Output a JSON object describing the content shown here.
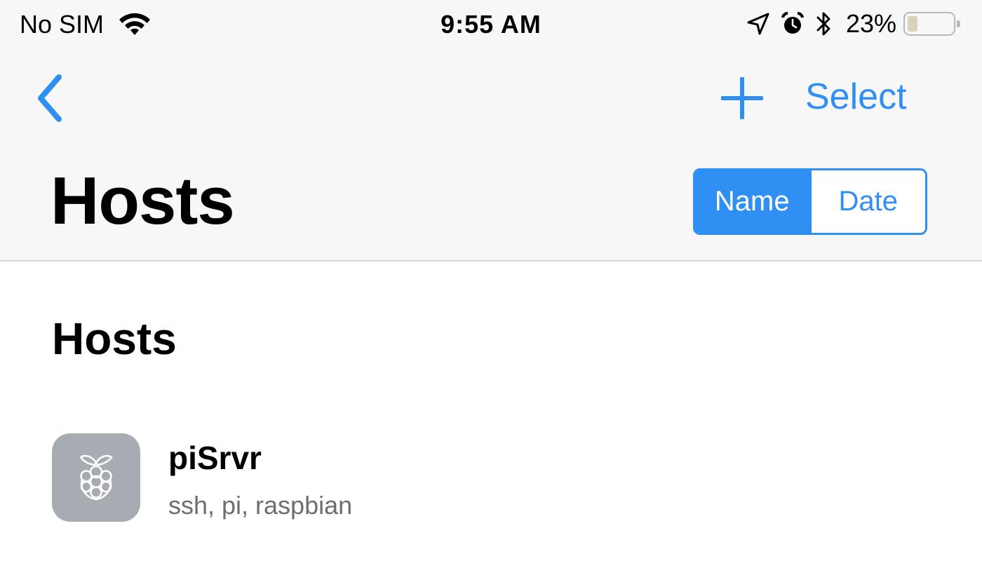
{
  "status_bar": {
    "carrier": "No SIM",
    "time": "9:55 AM",
    "battery_percent": "23%",
    "battery_level": 0.23,
    "icons": [
      "wifi-icon",
      "location-arrow-icon",
      "alarm-clock-icon",
      "bluetooth-icon",
      "battery-icon"
    ]
  },
  "nav": {
    "back_icon": "chevron-left-icon",
    "add_icon": "plus-icon",
    "select_label": "Select",
    "title": "Hosts"
  },
  "sort": {
    "options": [
      "Name",
      "Date"
    ],
    "selected": "Name"
  },
  "section": {
    "header": "Hosts"
  },
  "hosts": [
    {
      "name": "piSrvr",
      "detail": "ssh, pi, raspbian",
      "icon": "raspberry-pi-icon"
    }
  ],
  "colors": {
    "accent": "#2f8ff2",
    "icon_bg": "#a7abb2",
    "secondary_text": "#6d6d72",
    "header_bg": "#f7f7f8"
  }
}
